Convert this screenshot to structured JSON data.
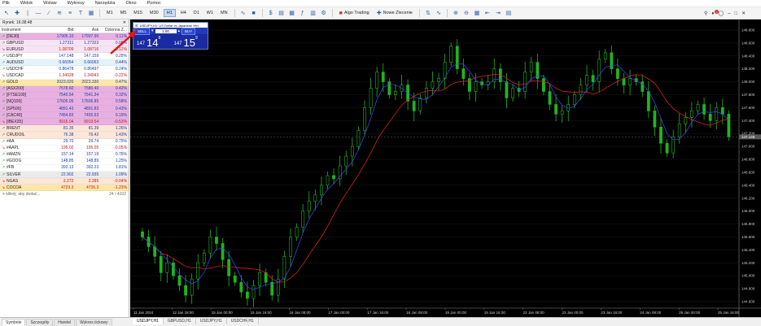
{
  "menu": [
    "Plik",
    "Widok",
    "Wstaw",
    "Wykresy",
    "Narzędzia",
    "Okno",
    "Pomoc"
  ],
  "toolbar": {
    "timeframes": [
      "M1",
      "M5",
      "M15",
      "M30",
      "H1",
      "H4",
      "D1",
      "W1",
      "MN"
    ],
    "active_timeframe": "H1",
    "algo_trading_label": "Algo Trading",
    "new_order_label": "Nowe Zlecenie",
    "notification_count": "2"
  },
  "market_watch": {
    "header": "Rynek: 16:38:48",
    "columns": {
      "instrument": "Instrument",
      "bid": "Bid",
      "ask": "Ask",
      "change": "Dzienna Z..."
    },
    "rows": [
      {
        "name": "[DE30]",
        "bid": "17905.10",
        "ask": "17907.90",
        "change": "0.11%",
        "bg": "#e8b0e0",
        "dir": "up"
      },
      {
        "name": "GBPUSD",
        "bid": "1.27311",
        "ask": "1.27323",
        "change": "0.08%",
        "bg": "#f6e4f2",
        "dir": "up"
      },
      {
        "name": "EURUSD",
        "bid": "1.08709",
        "ask": "1.08716",
        "change": "-0.12%",
        "bg": "#f6e4f2",
        "dir": "down"
      },
      {
        "name": "USDJPY",
        "bid": "147.148",
        "ask": "147.159",
        "change": "0.25%",
        "bg": "#ffffff",
        "dir": "up"
      },
      {
        "name": "AUDUSD",
        "bid": "0.66054",
        "ask": "0.66063",
        "change": "0.44%",
        "bg": "#e4f2fb",
        "dir": "up"
      },
      {
        "name": "USDCHF",
        "bid": "0.86478",
        "ask": "0.86497",
        "change": "0.24%",
        "bg": "#ffffff",
        "dir": "up"
      },
      {
        "name": "USDCAD",
        "bid": "1.34928",
        "ask": "1.34943",
        "change": "-0.22%",
        "bg": "#ffffff",
        "dir": "down"
      },
      {
        "name": "GOLD",
        "bid": "2023.020",
        "ask": "2023.330",
        "change": "0.47%",
        "bg": "#fde7a8",
        "dir": "up"
      },
      {
        "name": "[ASX200]",
        "bid": "7578.60",
        "ask": "7580.40",
        "change": "0.42%",
        "bg": "#e8b0e0",
        "dir": "up"
      },
      {
        "name": "[FTSE100]",
        "bid": "7540.54",
        "ask": "7541.34",
        "change": "0.32%",
        "bg": "#e8b0e0",
        "dir": "up"
      },
      {
        "name": "[NQ100]",
        "bid": "17605.05",
        "ask": "17606.85",
        "change": "0.58%",
        "bg": "#e8b0e0",
        "dir": "up"
      },
      {
        "name": "[SP500]",
        "bid": "4891.43",
        "ask": "4891.83",
        "change": "0.43%",
        "bg": "#e8b0e0",
        "dir": "up"
      },
      {
        "name": "[CAC40]",
        "bid": "7454.83",
        "ask": "7455.63",
        "change": "0.19%",
        "bg": "#e8b0e0",
        "dir": "up"
      },
      {
        "name": "[IBEX35]",
        "bid": "9916.04",
        "ask": "9919.54",
        "change": "-0.53%",
        "bg": "#e8b0e0",
        "dir": "down"
      },
      {
        "name": "BRENT",
        "bid": "81.35",
        "ask": "81.39",
        "change": "1.26%",
        "bg": "#fbe6d8",
        "dir": "up"
      },
      {
        "name": "CRUDOIL",
        "bid": "76.38",
        "ask": "76.42",
        "change": "1.43%",
        "bg": "#fbe6d8",
        "dir": "up"
      },
      {
        "name": "#AA",
        "bid": "29.70",
        "ask": "29.74",
        "change": "0.75%",
        "bg": "#ffffff",
        "dir": "up"
      },
      {
        "name": "#AAPL",
        "bid": "195.02",
        "ask": "195.05",
        "change": "-0.05%",
        "bg": "#ffffff",
        "dir": "down"
      },
      {
        "name": "#AMZN",
        "bid": "157.14",
        "ask": "157.19",
        "change": "0.76%",
        "bg": "#ffffff",
        "dir": "up"
      },
      {
        "name": "#GOOG",
        "bid": "148.85",
        "ask": "148.89",
        "change": "1.25%",
        "bg": "#ffffff",
        "dir": "up"
      },
      {
        "name": "#FB",
        "bid": "392.13",
        "ask": "392.23",
        "change": "1.81%",
        "bg": "#ffffff",
        "dir": "up"
      },
      {
        "name": "SILVER",
        "bid": "22.902",
        "ask": "22.935",
        "change": "1.09%",
        "bg": "#ebebeb",
        "dir": "up"
      },
      {
        "name": "NGAS",
        "bid": "2.272",
        "ask": "2.285",
        "change": "-0.04%",
        "bg": "#fbe6d8",
        "dir": "down"
      },
      {
        "name": "COCOA",
        "bid": "4723.3",
        "ask": "4726.3",
        "change": "-1.23%",
        "bg": "#fde7a8",
        "dir": "down"
      }
    ],
    "add_label": "kliknij, aby dodać...",
    "count_label": "24 / 4102",
    "tabs": [
      "Symbole",
      "Szczegóły",
      "Handel",
      "Wykres tickowy"
    ]
  },
  "trade_panel": {
    "title": "USDJPY,H1: US Dollar vs Japanese Yen",
    "sell_label": "SELL",
    "buy_label": "BUY",
    "lot": "1.00",
    "sell_price_small": "147",
    "sell_price_big": "14",
    "sell_price_sup": "8",
    "buy_price_small": "147",
    "buy_price_big": "15",
    "buy_price_sup": "9"
  },
  "chart_tabs": [
    "USDJPY,H1",
    "GBPUSD,H1",
    "USDJPY,H1",
    "USDCHF,H1"
  ],
  "chart_data": {
    "type": "candlestick",
    "symbol": "USDJPY",
    "timeframe": "H1",
    "y_ticks": [
      "148.800",
      "148.600",
      "148.400",
      "148.200",
      "148.000",
      "147.800",
      "147.600",
      "147.400",
      "147.200",
      "147.000",
      "146.800",
      "146.600",
      "146.400",
      "146.200",
      "146.000",
      "145.800",
      "145.600",
      "145.400",
      "145.200",
      "145.000",
      "144.800",
      "144.600"
    ],
    "ylim": [
      144.5,
      148.9
    ],
    "x_ticks": [
      "11 Jan 2024",
      "12 Jan 16:00",
      "15 Jan 00:00",
      "15 Jan 16:00",
      "16 Jan 08:00",
      "17 Jan 00:00",
      "17 Jan 16:00",
      "18 Jan 08:00",
      "19 Jan 00:00",
      "19 Jan 16:00",
      "22 Jan 08:00",
      "23 Jan 00:00",
      "23 Jan 16:00",
      "24 Jan 08:00",
      "25 Jan 00:00",
      "25 Jan 16:00"
    ],
    "current_price_label": "147.148",
    "colors": {
      "bull": "#1fb51f",
      "bear": "#1fb51f",
      "ma_fast": "#3a4cff",
      "ma_slow": "#d4202a",
      "grid": "#ffffff"
    },
    "closes": [
      145.6,
      145.45,
      145.3,
      145.05,
      145.2,
      145.0,
      144.85,
      144.7,
      144.95,
      145.2,
      145.35,
      145.6,
      145.5,
      145.25,
      145.0,
      144.9,
      144.75,
      144.65,
      144.85,
      145.05,
      144.9,
      144.7,
      144.95,
      145.3,
      145.6,
      145.75,
      146.0,
      146.15,
      146.25,
      146.4,
      146.55,
      146.5,
      146.7,
      146.85,
      147.0,
      147.25,
      147.6,
      147.9,
      148.15,
      148.0,
      147.8,
      147.85,
      147.95,
      147.7,
      147.55,
      147.75,
      147.9,
      148.0,
      148.05,
      148.3,
      148.55,
      148.2,
      148.05,
      147.85,
      148.0,
      147.95,
      148.0,
      148.2,
      148.0,
      147.75,
      147.9,
      147.85,
      148.15,
      148.3,
      148.05,
      147.85,
      147.65,
      147.5,
      147.55,
      147.65,
      147.8,
      147.95,
      148.1,
      148.0,
      148.35,
      148.45,
      148.2,
      148.05,
      147.95,
      148.05,
      148.0,
      147.85,
      147.55,
      147.3,
      147.05,
      146.9,
      147.15,
      147.35,
      147.45,
      147.55,
      147.65,
      147.5,
      147.4,
      147.6,
      147.5,
      147.15
    ]
  }
}
